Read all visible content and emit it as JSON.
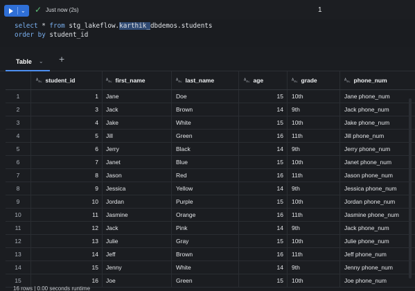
{
  "cell": {
    "run_caret": "⌄",
    "status_icon": "✓",
    "status_text": "Just now (2s)",
    "cell_number": "1"
  },
  "code": {
    "line1": {
      "kw_select": "select",
      "star": " * ",
      "kw_from": "from",
      "pre": " stg_lakeflow.",
      "highlight": "karthik_",
      "post": "dbdemos.students"
    },
    "line2": {
      "kw_order": "order",
      "by": " by ",
      "col": "student_id"
    }
  },
  "results": {
    "tab_label": "Table",
    "tab_chevron": "⌄",
    "add_tab": "+",
    "type_icon": "ᴬ₈꜀",
    "columns": [
      "student_id",
      "first_name",
      "last_name",
      "age",
      "grade",
      "phone_num"
    ],
    "rows": [
      [
        "1",
        "1",
        "Jane",
        "Doe",
        "15",
        "10th",
        "Jane phone_num"
      ],
      [
        "2",
        "3",
        "Jack",
        "Brown",
        "14",
        "9th",
        "Jack phone_num"
      ],
      [
        "3",
        "4",
        "Jake",
        "White",
        "15",
        "10th",
        "Jake phone_num"
      ],
      [
        "4",
        "5",
        "Jill",
        "Green",
        "16",
        "11th",
        "Jill phone_num"
      ],
      [
        "5",
        "6",
        "Jerry",
        "Black",
        "14",
        "9th",
        "Jerry phone_num"
      ],
      [
        "6",
        "7",
        "Janet",
        "Blue",
        "15",
        "10th",
        "Janet phone_num"
      ],
      [
        "7",
        "8",
        "Jason",
        "Red",
        "16",
        "11th",
        "Jason phone_num"
      ],
      [
        "8",
        "9",
        "Jessica",
        "Yellow",
        "14",
        "9th",
        "Jessica phone_num"
      ],
      [
        "9",
        "10",
        "Jordan",
        "Purple",
        "15",
        "10th",
        "Jordan phone_num"
      ],
      [
        "10",
        "11",
        "Jasmine",
        "Orange",
        "16",
        "11th",
        "Jasmine phone_num"
      ],
      [
        "11",
        "12",
        "Jack",
        "Pink",
        "14",
        "9th",
        "Jack phone_num"
      ],
      [
        "12",
        "13",
        "Julie",
        "Gray",
        "15",
        "10th",
        "Julie phone_num"
      ],
      [
        "13",
        "14",
        "Jeff",
        "Brown",
        "16",
        "11th",
        "Jeff phone_num"
      ],
      [
        "14",
        "15",
        "Jenny",
        "White",
        "14",
        "9th",
        "Jenny phone_num"
      ],
      [
        "15",
        "16",
        "Joe",
        "Green",
        "15",
        "10th",
        "Joe phone_num"
      ]
    ],
    "footer": "16 rows  |  0.00 seconds runtime"
  },
  "colors": {
    "run_button": "#2f6fd6",
    "status_ok": "#5fc27a",
    "keyword": "#7ab0f0",
    "selection": "#2f4a73",
    "tab_underline": "#4d8ff0"
  }
}
